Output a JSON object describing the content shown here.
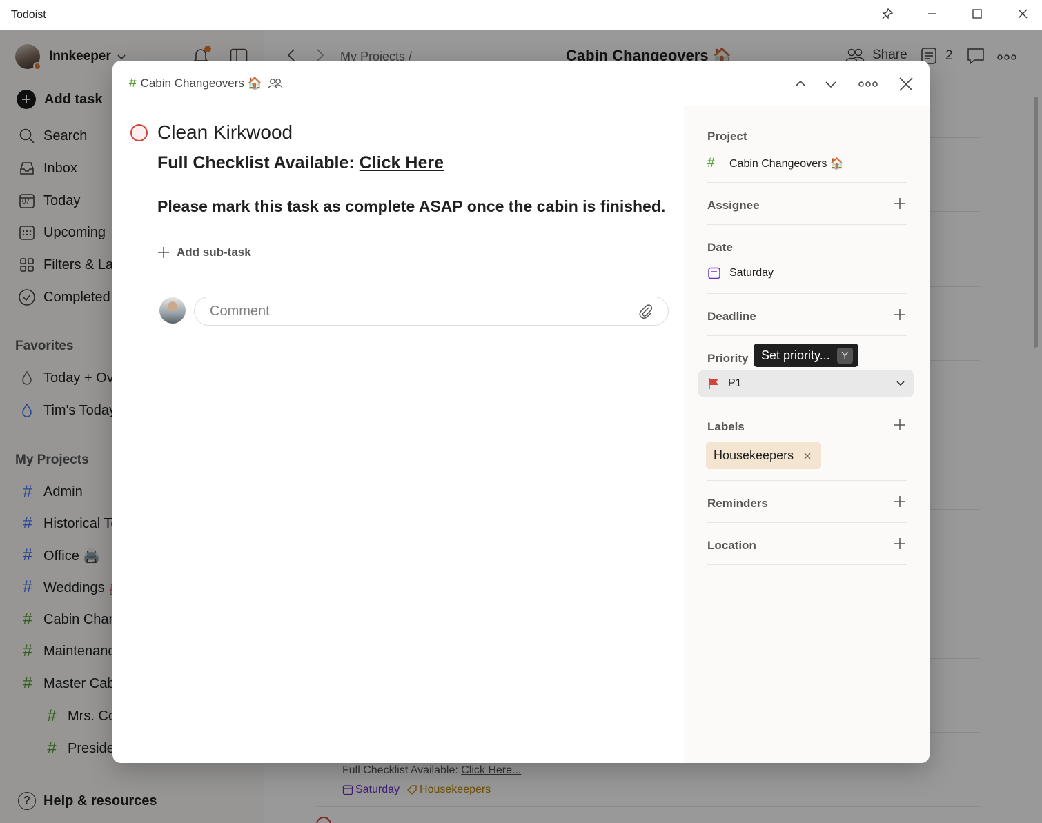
{
  "window": {
    "title": "Todoist"
  },
  "sidebar": {
    "user_name": "Innkeeper",
    "add_task": "Add task",
    "nav": [
      {
        "label": "Search",
        "icon": "search-icon"
      },
      {
        "label": "Inbox",
        "icon": "inbox-icon"
      },
      {
        "label": "Today",
        "icon": "calendar-today-icon",
        "day": "07"
      },
      {
        "label": "Upcoming",
        "icon": "calendar-grid-icon"
      },
      {
        "label": "Filters & Labels",
        "icon": "grid-icon"
      },
      {
        "label": "Completed",
        "icon": "check-circle-icon"
      }
    ],
    "favorites_title": "Favorites",
    "favorites": [
      {
        "label": "Today + Overdue"
      },
      {
        "label": "Tim's Today"
      }
    ],
    "projects_title": "My Projects",
    "projects": [
      {
        "label": "Admin",
        "color": "#4073ff"
      },
      {
        "label": "Historical Tours",
        "color": "#4073ff"
      },
      {
        "label": "Office 🖨️",
        "color": "#4073ff"
      },
      {
        "label": "Weddings 💒",
        "color": "#4073ff"
      },
      {
        "label": "Cabin Changeovers",
        "color": "#4f9e2c"
      },
      {
        "label": "Maintenance",
        "color": "#4f9e2c"
      },
      {
        "label": "Master Cabins",
        "color": "#4f9e2c"
      },
      {
        "label": "Mrs. Co",
        "color": "#4f9e2c"
      },
      {
        "label": "President",
        "color": "#4f9e2c"
      }
    ],
    "help": "Help & resources"
  },
  "main": {
    "breadcrumb": "My Projects /",
    "title": "Cabin Changeovers 🏠",
    "share": "Share",
    "count": "2",
    "bg_task": {
      "desc_prefix": "Full Checklist Available: ",
      "desc_link": "Click Here...",
      "date": "Saturday",
      "label": "Housekeepers"
    }
  },
  "modal": {
    "project_crumb": "Cabin Changeovers 🏠",
    "task_title": "Clean Kirkwood",
    "desc_prefix": "Full Checklist Available: ",
    "desc_link": "Click Here",
    "desc_line2": "Please mark this task as complete ASAP once the cabin is finished.",
    "add_subtask": "Add sub-task",
    "comment_placeholder": "Comment",
    "side": {
      "project_label": "Project",
      "project_value": "Cabin Changeovers 🏠",
      "assignee_label": "Assignee",
      "date_label": "Date",
      "date_value": "Saturday",
      "deadline_label": "Deadline",
      "priority_label": "Priority",
      "priority_value": "P1",
      "priority_color": "#d1453b",
      "tooltip_text": "Set priority...",
      "tooltip_key": "Y",
      "labels_label": "Labels",
      "label_chip": "Housekeepers",
      "reminders_label": "Reminders",
      "location_label": "Location"
    }
  }
}
